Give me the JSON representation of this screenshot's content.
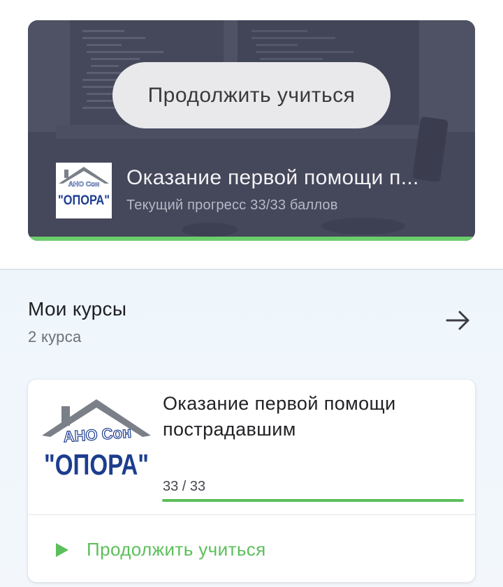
{
  "hero": {
    "continue_label": "Продолжить учиться",
    "course_title": "Оказание первой помощи п...",
    "progress_text": "Текущий прогресс 33/33 баллов",
    "progress_fraction": 1.0
  },
  "my_courses": {
    "title": "Мои курсы",
    "count": "2 курса"
  },
  "course_card": {
    "title": "Оказание первой помощи пострадавшим",
    "score": "33 / 33",
    "progress_fraction": 1.0,
    "continue_label": "Продолжить учиться"
  },
  "logo": {
    "top_text": "АНО Сон",
    "main_text": "\"ОПОРА\""
  },
  "colors": {
    "accent_green": "#5cbf5b",
    "logo_blue": "#1d3d8f",
    "logo_gray": "#7a7f88"
  },
  "icons": {
    "arrow": "arrow-right-icon",
    "play": "play-icon"
  }
}
